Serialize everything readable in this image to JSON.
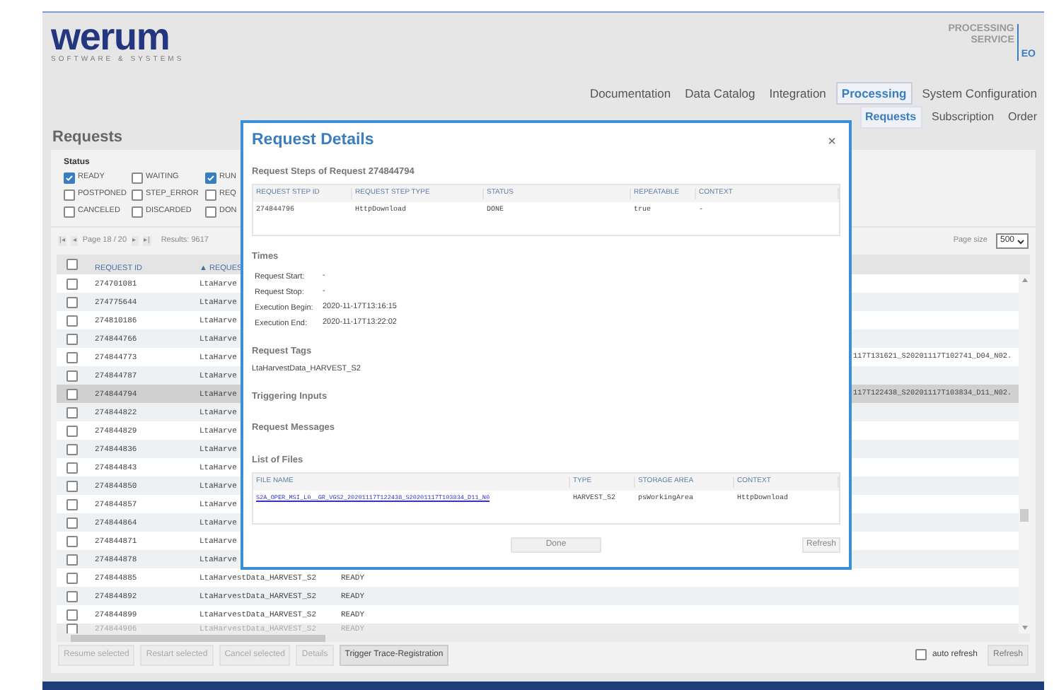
{
  "header": {
    "logo": "werum",
    "logo_tagline": "SOFTWARE & SYSTEMS",
    "product": "PROCESSING SERVICE",
    "product_badge": "EO"
  },
  "nav": [
    {
      "label": "Documentation",
      "selected": false
    },
    {
      "label": "Data Catalog",
      "selected": false
    },
    {
      "label": "Integration",
      "selected": false
    },
    {
      "label": "Processing",
      "selected": true
    },
    {
      "label": "System Configuration",
      "selected": false
    }
  ],
  "subnav": [
    {
      "label": "Requests",
      "selected": true
    },
    {
      "label": "Subscription",
      "selected": false
    },
    {
      "label": "Order",
      "selected": false
    }
  ],
  "page_title": "Requests",
  "status_filter": {
    "label": "Status",
    "options": [
      {
        "label": "READY",
        "checked": true
      },
      {
        "label": "WAITING",
        "checked": false
      },
      {
        "label": "RUN",
        "checked": true
      },
      {
        "label": "POSTPONED",
        "checked": false
      },
      {
        "label": "STEP_ERROR",
        "checked": false
      },
      {
        "label": "REQ",
        "checked": false
      },
      {
        "label": "CANCELED",
        "checked": false
      },
      {
        "label": "DISCARDED",
        "checked": false
      },
      {
        "label": "DON",
        "checked": false
      }
    ]
  },
  "pagination": {
    "first": "|◂",
    "prev": "◂",
    "page": "Page 18 / 20",
    "next": "▸",
    "last": "▸|",
    "results": "Results: 9617",
    "page_size_label": "Page size",
    "page_size": "500"
  },
  "table": {
    "columns": [
      "REQUEST ID",
      "▲ REQUES"
    ],
    "rows": [
      {
        "id": "274701081",
        "type": "LtaHarve",
        "selected": false,
        "checked": false
      },
      {
        "id": "274775644",
        "type": "LtaHarve",
        "selected": false,
        "checked": false
      },
      {
        "id": "274810186",
        "type": "LtaHarve",
        "selected": false,
        "checked": false
      },
      {
        "id": "274844766",
        "type": "LtaHarve",
        "selected": false,
        "checked": false
      },
      {
        "id": "274844773",
        "type": "LtaHarve",
        "selected": false,
        "checked": false,
        "column_5": "117T131621_S20201117T102741_D04_N02."
      },
      {
        "id": "274844787",
        "type": "LtaHarve",
        "selected": false,
        "checked": false
      },
      {
        "id": "274844794",
        "type": "LtaHarve",
        "selected": true,
        "checked": false,
        "column_5": "117T122438_S20201117T103834_D11_N02."
      },
      {
        "id": "274844822",
        "type": "LtaHarve",
        "selected": false,
        "checked": false
      },
      {
        "id": "274844829",
        "type": "LtaHarve",
        "selected": false,
        "checked": false
      },
      {
        "id": "274844836",
        "type": "LtaHarve",
        "selected": false,
        "checked": false
      },
      {
        "id": "274844843",
        "type": "LtaHarve",
        "selected": false,
        "checked": false
      },
      {
        "id": "274844850",
        "type": "LtaHarve",
        "selected": false,
        "checked": false
      },
      {
        "id": "274844857",
        "type": "LtaHarve",
        "selected": false,
        "checked": false
      },
      {
        "id": "274844864",
        "type": "LtaHarve",
        "selected": false,
        "checked": false
      },
      {
        "id": "274844871",
        "type": "LtaHarve",
        "selected": false,
        "checked": false
      },
      {
        "id": "274844878",
        "type": "LtaHarve",
        "selected": false,
        "checked": false
      },
      {
        "id": "274844885",
        "type": "LtaHarvestData_HARVEST_S2",
        "status": "READY",
        "selected": false,
        "checked": false
      },
      {
        "id": "274844892",
        "type": "LtaHarvestData_HARVEST_S2",
        "status": "READY",
        "selected": false,
        "checked": false
      },
      {
        "id": "274844899",
        "type": "LtaHarvestData_HARVEST_S2",
        "status": "READY",
        "selected": false,
        "checked": false
      },
      {
        "id": "274844906",
        "type": "LtaHarvestData_HARVEST_S2",
        "status": "READY",
        "selected": false,
        "checked": false
      }
    ],
    "header_checked": false
  },
  "actions": [
    {
      "label": "Resume selected",
      "disabled": true
    },
    {
      "label": "Restart selected",
      "disabled": true
    },
    {
      "label": "Cancel selected",
      "disabled": true
    },
    {
      "label": "Details",
      "disabled": true
    },
    {
      "label": "Trigger Trace-Registration",
      "disabled": false
    }
  ],
  "auto_refresh": {
    "label": "auto refresh",
    "checked": false
  },
  "refresh_button": "Refresh",
  "dialog": {
    "title": "Request Details",
    "close": "×",
    "steps_heading": "Request Steps of Request 274844794",
    "steps_columns": [
      "REQUEST STEP ID",
      "REQUEST STEP TYPE",
      "STATUS",
      "REPEATABLE",
      "CONTEXT"
    ],
    "steps_rows": [
      [
        "274844796",
        "HttpDownload",
        "DONE",
        "true",
        "-"
      ]
    ],
    "times_heading": "Times",
    "times": [
      {
        "label": "Request Start:",
        "value": "-"
      },
      {
        "label": "Request Stop:",
        "value": "-"
      },
      {
        "label": "Execution Begin:",
        "value": "2020-11-17T13:16:15"
      },
      {
        "label": "Execution End:",
        "value": "2020-11-17T13:22:02"
      }
    ],
    "tags_heading": "Request Tags",
    "tags": "LtaHarvestData_HARVEST_S2",
    "inputs_heading": "Triggering Inputs",
    "messages_heading": "Request Messages",
    "files_heading": "List of Files",
    "files_columns": [
      "FILE NAME",
      "TYPE",
      "STORAGE AREA",
      "CONTEXT"
    ],
    "files_rows": [
      [
        "S2A_OPER_MSI_L0__GR_VGS2_20201117T122438_S20201117T103834_D11_N0",
        "HARVEST_S2",
        "psWorkingArea",
        "HttpDownload"
      ]
    ],
    "done": "Done",
    "refresh": "Refresh"
  }
}
